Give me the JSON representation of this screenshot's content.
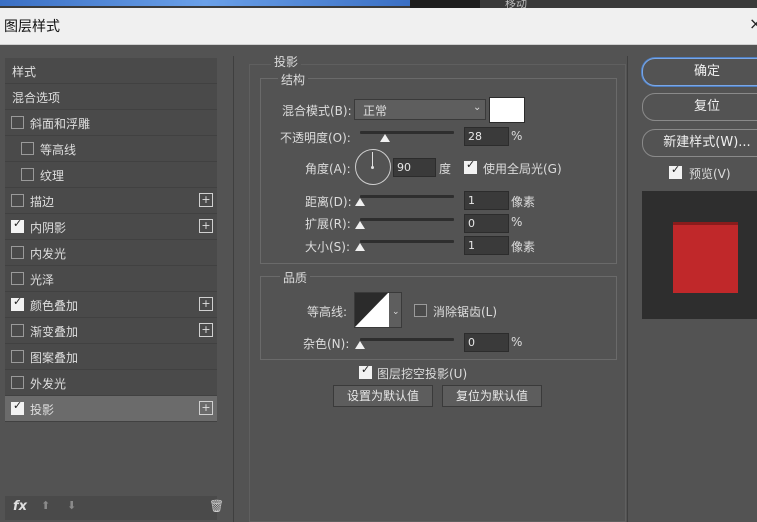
{
  "topbar": {
    "move_label": "移动"
  },
  "dialog": {
    "title": "图层样式",
    "close": "×"
  },
  "left": {
    "items": [
      {
        "label": "样式",
        "checkbox": null,
        "plus": false
      },
      {
        "label": "混合选项",
        "checkbox": null,
        "plus": false
      },
      {
        "label": "斜面和浮雕",
        "checkbox": false,
        "plus": false
      },
      {
        "label": "等高线",
        "checkbox": false,
        "plus": false
      },
      {
        "label": "纹理",
        "checkbox": false,
        "plus": false
      },
      {
        "label": "描边",
        "checkbox": false,
        "plus": true
      },
      {
        "label": "内阴影",
        "checkbox": true,
        "plus": true
      },
      {
        "label": "内发光",
        "checkbox": false,
        "plus": false
      },
      {
        "label": "光泽",
        "checkbox": false,
        "plus": false
      },
      {
        "label": "颜色叠加",
        "checkbox": true,
        "plus": true
      },
      {
        "label": "渐变叠加",
        "checkbox": false,
        "plus": true
      },
      {
        "label": "图案叠加",
        "checkbox": false,
        "plus": false
      },
      {
        "label": "外发光",
        "checkbox": false,
        "plus": false
      },
      {
        "label": "投影",
        "checkbox": true,
        "plus": true
      }
    ],
    "footer": {
      "fx": "fx",
      "up": "⬆",
      "down": "⬇",
      "trash": "🗑"
    }
  },
  "section": {
    "title": "投影"
  },
  "structure": {
    "title": "结构",
    "blend_mode_label": "混合模式(B):",
    "blend_mode_value": "正常",
    "opacity_label": "不透明度(O):",
    "opacity_value": "28",
    "opacity_unit": "%",
    "angle_label": "角度(A):",
    "angle_value": "90",
    "angle_unit": "度",
    "global_light_label": "使用全局光(G)",
    "global_light_checked": true,
    "distance_label": "距离(D):",
    "distance_value": "1",
    "distance_unit": "像素",
    "spread_label": "扩展(R):",
    "spread_value": "0",
    "spread_unit": "%",
    "size_label": "大小(S):",
    "size_value": "1",
    "size_unit": "像素",
    "shadow_color": "#ffffff"
  },
  "quality": {
    "title": "品质",
    "contour_label": "等高线:",
    "antialias_label": "消除锯齿(L)",
    "antialias_checked": false,
    "noise_label": "杂色(N):",
    "noise_value": "0",
    "noise_unit": "%"
  },
  "knockout": {
    "label": "图层挖空投影(U)",
    "checked": true
  },
  "buttons": {
    "make_default": "设置为默认值",
    "reset_default": "复位为默认值"
  },
  "right": {
    "ok": "确定",
    "reset": "复位",
    "new_style": "新建样式(W)...",
    "preview_label": "预览(V)",
    "preview_checked": true,
    "preview_swatch_color": "#c0282a"
  }
}
